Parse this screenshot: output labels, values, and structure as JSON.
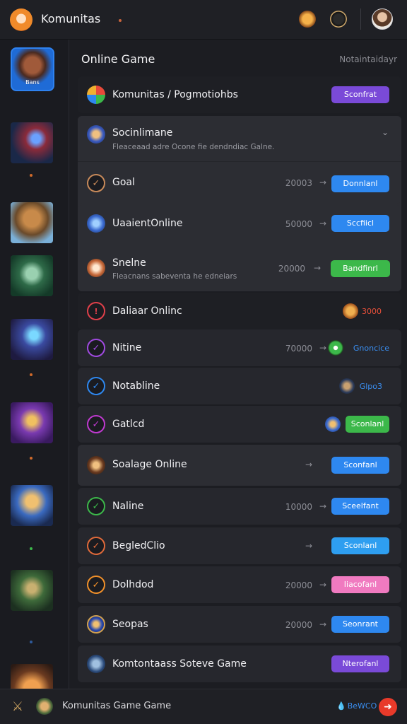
{
  "app": {
    "title": "Komunitas"
  },
  "rail": {
    "featured_caption": "Bans"
  },
  "main": {
    "section_title": "Online Game",
    "section_meta": "Notaintaidayr"
  },
  "rows": [
    {
      "title": "Komunitas / Pogmotiohbs",
      "button": "Sconfrat",
      "button_color": "#7a4ad8"
    },
    {
      "title": "Socinlimane",
      "subtitle": "Fleaceaad adre Ocone fie dendndiac Galne.",
      "chevron": "chevron-down-icon"
    },
    {
      "title": "Goal",
      "value": "20003",
      "button": "Donnlanl",
      "button_color": "#2e88f0"
    },
    {
      "title": "UaaientOnline",
      "value": "50000",
      "button": "Sccfiicl",
      "button_color": "#2e88f0"
    },
    {
      "title": "Snelne",
      "subtitle": "Fleacnans sabeventa he edneiars",
      "value": "20000",
      "button": "Bandfinrl",
      "button_color": "#3cb84a"
    },
    {
      "title": "Daliaar Onlinc",
      "status": "3000",
      "status_color": "#e8503a"
    },
    {
      "title": "Nitine",
      "value": "70000",
      "status": "Gnoncice",
      "status_color": "#3a8ef0"
    },
    {
      "title": "Notabline",
      "status": "Glpo3",
      "status_color": "#3a8ef0"
    },
    {
      "title": "Gatlcd",
      "button": "Sconlanl",
      "button_color": "#3cb84a"
    },
    {
      "title": "Soalage Online",
      "button": "Sconfanl",
      "button_color": "#2e88f0"
    },
    {
      "title": "Naline",
      "value": "10000",
      "button": "Sceelfant",
      "button_color": "#2e88f0"
    },
    {
      "title": "BegledClio",
      "button": "Sconlanl",
      "button_color": "#2e9ef0"
    },
    {
      "title": "Dolhdod",
      "value": "20000",
      "button": "Iiacofanl",
      "button_color": "#f07ac0"
    },
    {
      "title": "Seopas",
      "value": "20000",
      "button": "Seonrant",
      "button_color": "#2e88f0"
    },
    {
      "title": "Komtontaass Soteve Game",
      "button": "Nterofanl",
      "button_color": "#7a4ad8"
    }
  ],
  "arrow_glyph": "→",
  "bottombar": {
    "title": "Komunitas Game Game",
    "status": "BeWCO",
    "status_icon": "💧",
    "action_icon": "arrow-right-icon"
  }
}
